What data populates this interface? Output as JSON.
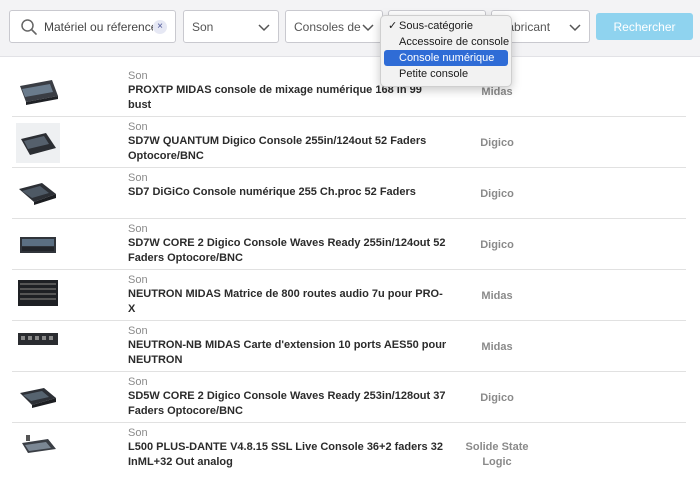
{
  "filters": {
    "search": {
      "value": "Matériel ou réference",
      "clear_glyph": "×"
    },
    "category_select": {
      "value": "Son"
    },
    "subcategory_select": {
      "value": "Consoles de M"
    },
    "select3": {
      "value": ""
    },
    "manufacturer_select": {
      "value": "Fabricant"
    },
    "search_button_label": "Rechercher",
    "accent_color": "#8fd3ef"
  },
  "dropdown": {
    "items": [
      {
        "label": "Sous-catégorie",
        "checked": true,
        "highlighted": false
      },
      {
        "label": "Accessoire de console",
        "checked": false,
        "highlighted": false
      },
      {
        "label": "Console numérique",
        "checked": false,
        "highlighted": true
      },
      {
        "label": "Petite console",
        "checked": false,
        "highlighted": false
      }
    ],
    "check_glyph": "✓",
    "highlight_color": "#2f6cd6"
  },
  "products": [
    {
      "category": "Son",
      "title": "PROXTP MIDAS console de mixage numérique 168 in 99 bust",
      "brand": "Midas"
    },
    {
      "category": "Son",
      "title": "SD7W QUANTUM Digico Console 255in/124out 52 Faders Optocore/BNC",
      "brand": "Digico"
    },
    {
      "category": "Son",
      "title": "SD7 DiGiCo Console numérique 255 Ch.proc 52 Faders",
      "brand": "Digico"
    },
    {
      "category": "Son",
      "title": "SD7W CORE 2 Digico Console Waves Ready 255in/124out 52 Faders Optocore/BNC",
      "brand": "Digico"
    },
    {
      "category": "Son",
      "title": "NEUTRON MIDAS Matrice de 800 routes audio 7u pour PRO-X",
      "brand": "Midas"
    },
    {
      "category": "Son",
      "title": "NEUTRON-NB MIDAS Carte d'extension 10 ports AES50 pour NEUTRON",
      "brand": "Midas"
    },
    {
      "category": "Son",
      "title": "SD5W CORE 2 Digico Console Waves Ready 253in/128out 37 Faders Optocore/BNC",
      "brand": "Digico"
    },
    {
      "category": "Son",
      "title": "L500 PLUS-DANTE V4.8.15 SSL Live Console 36+2 faders 32 InML+32 Out analog",
      "brand": "Solide State Logic"
    }
  ]
}
